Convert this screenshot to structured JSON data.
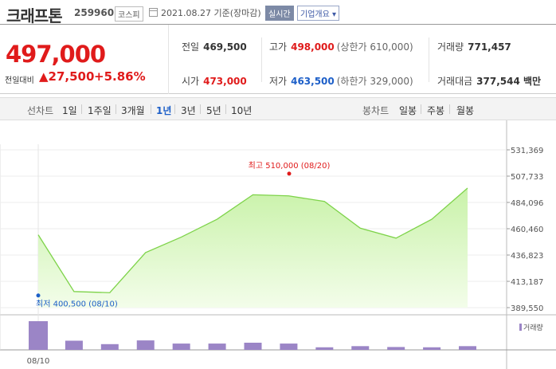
{
  "header": {
    "company": "크래프톤",
    "code": "259960",
    "market": "코스피",
    "date_info": "2021.08.27 기준(장마감)",
    "realtime_badge": "실시간",
    "overview_button": "기업개요 ▾"
  },
  "quote": {
    "price": "497,000",
    "change_label": "전일대비",
    "change_value": "▲27,500",
    "change_pct": "+5.86%",
    "prev_close_label": "전일",
    "prev_close": "469,500",
    "high_label": "고가",
    "high": "498,000",
    "high_limit": "(상한가 610,000)",
    "volume_label": "거래량",
    "volume": "771,457",
    "open_label": "시가",
    "open": "473,000",
    "low_label": "저가",
    "low": "463,500",
    "low_limit": "(하한가 329,000)",
    "amount_label": "거래대금",
    "amount": "377,544 백만"
  },
  "tabs": {
    "line_label": "선차트",
    "line_periods": [
      "1일",
      "1주일",
      "3개월",
      "1년",
      "3년",
      "5년",
      "10년"
    ],
    "active_period": "1년",
    "candle_label": "봉차트",
    "candle_periods": [
      "일봉",
      "주봉",
      "월봉"
    ]
  },
  "colors": {
    "up": "#e01b1b",
    "down": "#1d5fc8",
    "line": "#7ed34a",
    "volume_bar": "#9b85c6"
  },
  "chart_data": {
    "type": "area",
    "y_ticks": [
      "531,369",
      "507,733",
      "484,096",
      "460,460",
      "436,823",
      "413,187",
      "389,550"
    ],
    "ylim": [
      389550,
      531369
    ],
    "x_tick_labels": [
      "08/10"
    ],
    "series": [
      {
        "values": [
          455000,
          404000,
          403000,
          439000,
          453000,
          469000,
          491000,
          490000,
          485000,
          461000,
          452000,
          469000,
          497000
        ]
      }
    ],
    "high_annotation": "최고 510,000 (08/20)",
    "low_annotation": "최저 400,500 (08/10)",
    "high_point": 510000,
    "low_point": 400500,
    "volume_legend": "거래량",
    "volume_values": [
      100,
      32,
      20,
      33,
      22,
      22,
      25,
      22,
      9,
      13,
      10,
      9,
      13
    ]
  }
}
